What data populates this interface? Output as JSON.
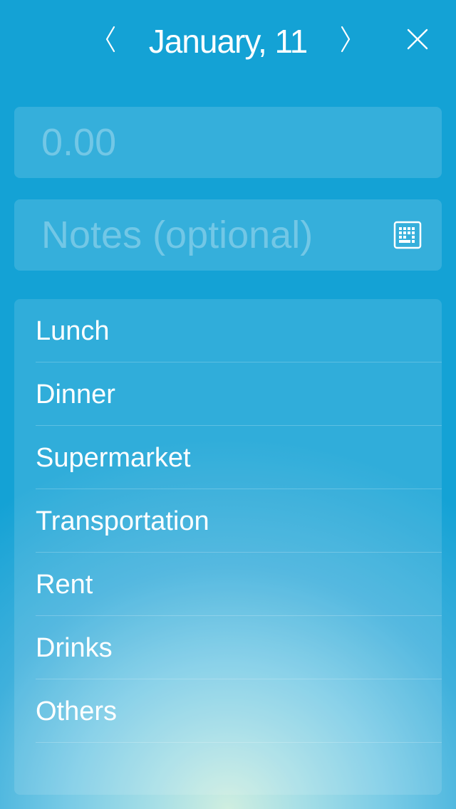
{
  "header": {
    "date": "January, 11",
    "prev_icon": "chevron-left-icon",
    "next_icon": "chevron-right-icon",
    "close_icon": "close-icon"
  },
  "amount": {
    "value": "",
    "placeholder": "0.00"
  },
  "notes": {
    "value": "",
    "placeholder": "Notes (optional)",
    "keyboard_icon": "keyboard-icon"
  },
  "categories": [
    {
      "label": "Lunch"
    },
    {
      "label": "Dinner"
    },
    {
      "label": "Supermarket"
    },
    {
      "label": "Transportation"
    },
    {
      "label": "Rent"
    },
    {
      "label": "Drinks"
    },
    {
      "label": "Others"
    }
  ],
  "colors": {
    "background": "#14a2d5",
    "text": "#ffffff"
  }
}
